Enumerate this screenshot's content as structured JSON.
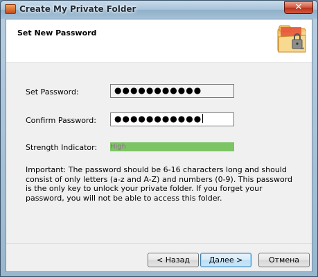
{
  "window": {
    "title": "Create My Private Folder",
    "close_label": "✕"
  },
  "header": {
    "title": "Set New Password",
    "icon": "folder-lock-icon"
  },
  "form": {
    "set_password_label": "Set Password:",
    "set_password_value": "●●●●●●●●●●●",
    "confirm_password_label": "Confirm Password:",
    "confirm_password_value": "●●●●●●●●●●●",
    "strength_label": "Strength Indicator:",
    "strength_value": "High",
    "strength_color": "#7cc464"
  },
  "info_text": "Important: The password should be 6-16 characters long and should consist of only letters (a-z and A-Z) and numbers (0-9). This password is the only key to unlock your private folder. If you forget your password, you will not be able to access this folder.",
  "buttons": {
    "back": "< Назад",
    "next": "Далее >",
    "cancel": "Отмена"
  }
}
